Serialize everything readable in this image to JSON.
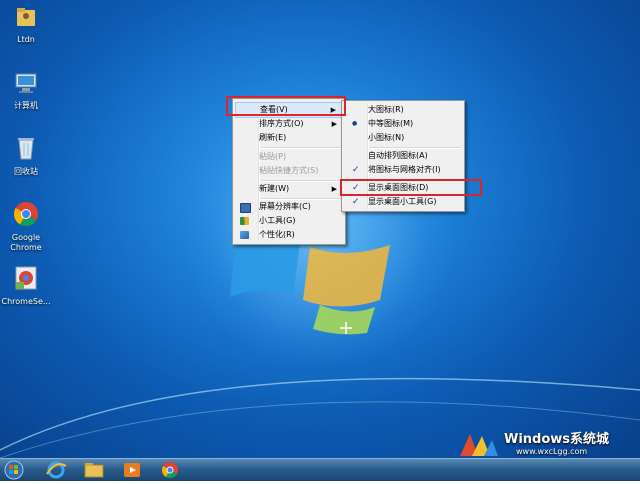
{
  "desktop_icons": [
    {
      "label": "Ltdn",
      "icon": "user-folder-icon"
    },
    {
      "label": "计算机",
      "icon": "computer-icon"
    },
    {
      "label": "回收站",
      "icon": "recycle-bin-icon"
    },
    {
      "label": "Google Chrome",
      "icon": "chrome-icon"
    },
    {
      "label": "ChromeSe...",
      "icon": "chromesetup-icon"
    }
  ],
  "context_menu": {
    "items": [
      {
        "label": "查看(V)",
        "submenu": true,
        "enabled": true
      },
      {
        "label": "排序方式(O)",
        "submenu": true,
        "enabled": true
      },
      {
        "label": "刷新(E)",
        "submenu": false,
        "enabled": true
      },
      {
        "label": "粘贴(P)",
        "submenu": false,
        "enabled": false
      },
      {
        "label": "粘贴快捷方式(S)",
        "submenu": false,
        "enabled": false
      },
      {
        "label": "新建(W)",
        "submenu": true,
        "enabled": true
      },
      {
        "label": "屏幕分辨率(C)",
        "icon": "screen-resolution-icon"
      },
      {
        "label": "小工具(G)",
        "icon": "gadgets-icon"
      },
      {
        "label": "个性化(R)",
        "icon": "personalize-icon"
      }
    ]
  },
  "view_submenu": {
    "items": [
      {
        "label": "大图标(R)",
        "mark": ""
      },
      {
        "label": "中等图标(M)",
        "mark": "●"
      },
      {
        "label": "小图标(N)",
        "mark": ""
      },
      {
        "label": "自动排列图标(A)",
        "mark": ""
      },
      {
        "label": "将图标与网格对齐(I)",
        "mark": "✓"
      },
      {
        "label": "显示桌面图标(D)",
        "mark": "✓"
      },
      {
        "label": "显示桌面小工具(G)",
        "mark": "✓"
      }
    ]
  },
  "watermark": {
    "brand": "Windows系统城",
    "url": "www.wxcLgg.com"
  },
  "taskbar": {
    "buttons": [
      "start-orb-icon",
      "ie-icon",
      "explorer-icon",
      "media-player-icon",
      "chrome-icon"
    ]
  },
  "colors": {
    "highlight": "#d9262b",
    "menu_bg": "#f0f0f0"
  }
}
